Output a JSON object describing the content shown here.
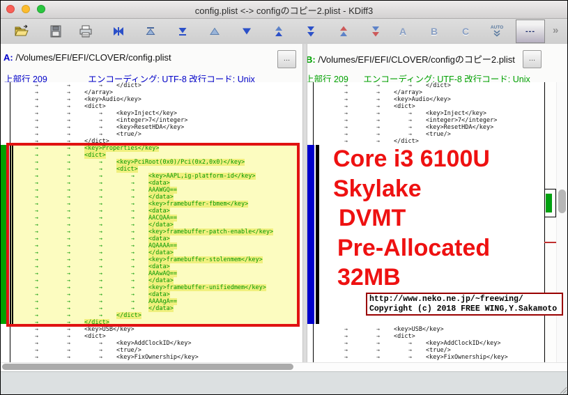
{
  "window": {
    "title": "config.plist <-> configのコピー2.plist - KDiff3"
  },
  "toolbar": {
    "buttons": [
      "open-file",
      "save",
      "print",
      "goto-current-delta",
      "goto-first-delta",
      "goto-last-delta",
      "goto-prev-delta",
      "goto-next-delta",
      "goto-prev-conflict",
      "goto-next-conflict",
      "goto-prev-unsolved-conflict",
      "goto-next-unsolved-conflict",
      "select-line-a",
      "select-line-b",
      "select-line-c",
      "auto-solve"
    ],
    "select_a_label": "A",
    "select_b_label": "B",
    "select_c_label": "C",
    "auto_label": "AUTO",
    "more_label": "---",
    "overflow_label": "»"
  },
  "panes": {
    "a": {
      "label": "A:",
      "path": "/Volumes/EFI/EFI/CLOVER/config.plist",
      "browse": "...",
      "info_position": "上部行 209",
      "info_encoding": "エンコーディング: UTF-8 改行コード: Unix",
      "accent": "#0000cc"
    },
    "b": {
      "label": "B:",
      "path": "/Volumes/EFI/EFI/CLOVER/configのコピー2.plist",
      "browse": "...",
      "info_position": "上部行 209",
      "info_encoding": "エンコーディング: UTF-8 改行コード: Unix",
      "accent": "#00a000"
    }
  },
  "code": {
    "common_top": [
      {
        "indent": 3,
        "text": "</dict>"
      },
      {
        "indent": 2,
        "text": "</array>"
      },
      {
        "indent": 2,
        "text": "<key>Audio</key>"
      },
      {
        "indent": 2,
        "text": "<dict>"
      },
      {
        "indent": 3,
        "text": "<key>Inject</key>"
      },
      {
        "indent": 3,
        "text": "<integer>7</integer>"
      },
      {
        "indent": 3,
        "text": "<key>ResetHDA</key>"
      },
      {
        "indent": 3,
        "text": "<true/>"
      },
      {
        "indent": 2,
        "text": "</dict>"
      }
    ],
    "diff_a_only": [
      {
        "indent": 2,
        "text": "<key>Properties</key>"
      },
      {
        "indent": 2,
        "text": "<dict>"
      },
      {
        "indent": 3,
        "text": "<key>PciRoot(0x0)/Pci(0x2,0x0)</key>"
      },
      {
        "indent": 3,
        "text": "<dict>"
      },
      {
        "indent": 4,
        "text": "<key>AAPL,ig-platform-id</key>"
      },
      {
        "indent": 4,
        "text": "<data>"
      },
      {
        "indent": 4,
        "text": "AAAWGQ=="
      },
      {
        "indent": 4,
        "text": "</data>"
      },
      {
        "indent": 4,
        "text": "<key>framebuffer-fbmem</key>"
      },
      {
        "indent": 4,
        "text": "<data>"
      },
      {
        "indent": 4,
        "text": "AACQAA=="
      },
      {
        "indent": 4,
        "text": "</data>"
      },
      {
        "indent": 4,
        "text": "<key>framebuffer-patch-enable</key>"
      },
      {
        "indent": 4,
        "text": "<data>"
      },
      {
        "indent": 4,
        "text": "AQAAAA=="
      },
      {
        "indent": 4,
        "text": "</data>"
      },
      {
        "indent": 4,
        "text": "<key>framebuffer-stolenmem</key>"
      },
      {
        "indent": 4,
        "text": "<data>"
      },
      {
        "indent": 4,
        "text": "AAAwAQ=="
      },
      {
        "indent": 4,
        "text": "</data>"
      },
      {
        "indent": 4,
        "text": "<key>framebuffer-unifiedmem</key>"
      },
      {
        "indent": 4,
        "text": "<data>"
      },
      {
        "indent": 4,
        "text": "AAAAgA=="
      },
      {
        "indent": 4,
        "text": "</data>"
      },
      {
        "indent": 3,
        "text": "</dict>"
      },
      {
        "indent": 2,
        "text": "</dict>"
      }
    ],
    "common_bottom": [
      {
        "indent": 2,
        "text": "<key>USB</key>"
      },
      {
        "indent": 2,
        "text": "<dict>"
      },
      {
        "indent": 3,
        "text": "<key>AddClockID</key>"
      },
      {
        "indent": 3,
        "text": "<true/>"
      },
      {
        "indent": 3,
        "text": "<key>FixOwnership</key>"
      }
    ]
  },
  "annotations": {
    "headline": [
      "Core i3 6100U",
      "Skylake",
      "DVMT",
      "Pre-Allocated",
      "32MB"
    ],
    "credit_line1": "http://www.neko.ne.jp/~freewing/",
    "credit_line2": "Copyright (c) 2018 FREE WING,Y.Sakamoto",
    "color": "#ee1111"
  },
  "colors": {
    "accent_a_blue": "#0000cc",
    "accent_b_green": "#00a000",
    "diff_text_green": "#009700",
    "diff_row_bg": "#fcfcc0",
    "diff_token_bg": "#f0f07e",
    "annotation_red": "#e01212",
    "overview_green": "#00a010",
    "missing_bar_blue": "#0000cc",
    "diff_margin_green": "#00a000"
  }
}
